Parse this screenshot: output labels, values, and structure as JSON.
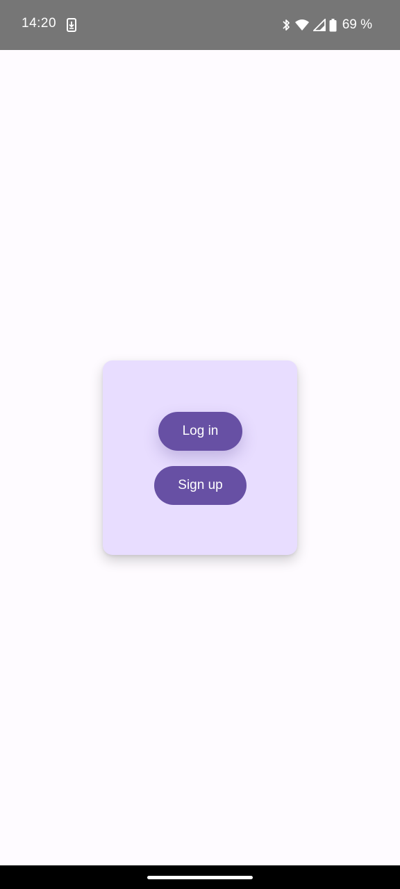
{
  "status_bar": {
    "time": "14:20",
    "icons": [
      "download-icon",
      "bluetooth-icon",
      "wifi-icon",
      "cell-signal-icon",
      "battery-icon"
    ],
    "battery_percent": "69 %",
    "background": "#767676"
  },
  "card": {
    "login_label": "Log in",
    "signup_label": "Sign up",
    "background": "#e8ddff",
    "button_color": "#6750a4"
  },
  "nav_bar": {
    "handle": "home-handle"
  }
}
